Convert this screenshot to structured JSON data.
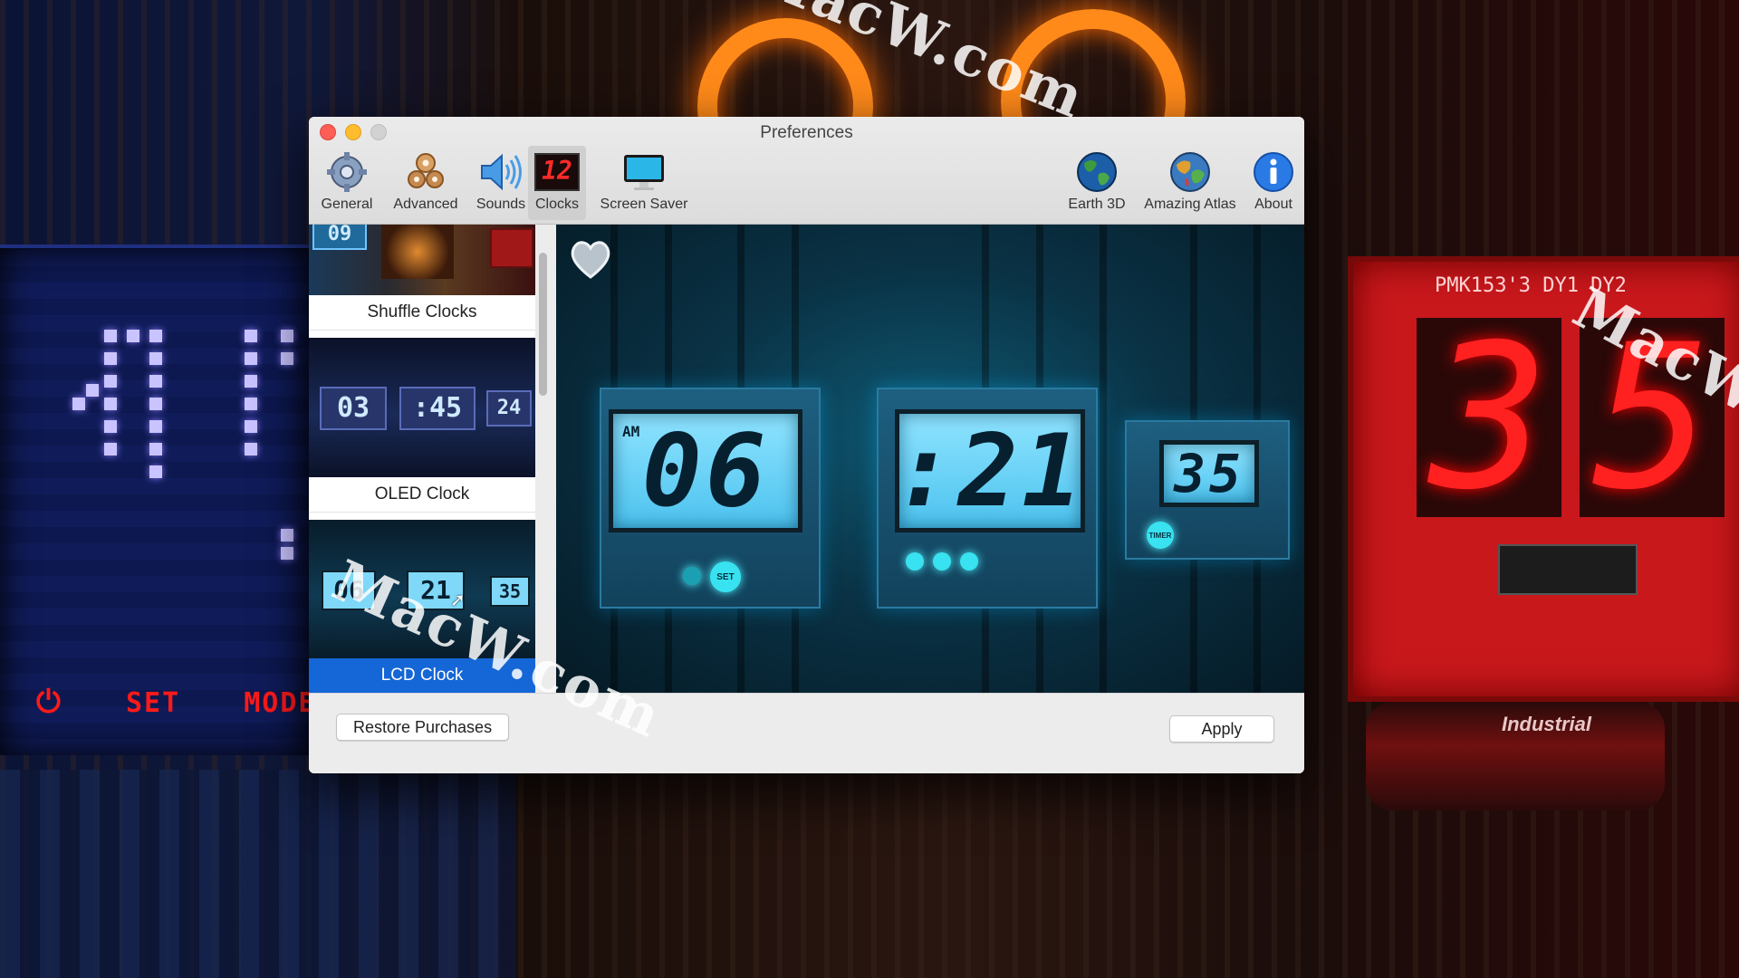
{
  "window": {
    "title": "Preferences"
  },
  "toolbar": {
    "items": [
      {
        "label": "General",
        "icon": "gear-icon"
      },
      {
        "label": "Advanced",
        "icon": "gears-icon"
      },
      {
        "label": "Sounds",
        "icon": "speaker-icon"
      },
      {
        "label": "Clocks",
        "icon": "clock-digit-icon"
      },
      {
        "label": "Screen Saver",
        "icon": "monitor-icon"
      },
      {
        "label": "Earth 3D",
        "icon": "earth-globe-icon"
      },
      {
        "label": "Amazing Atlas",
        "icon": "atlas-globe-icon"
      },
      {
        "label": "About",
        "icon": "info-icon"
      }
    ],
    "selected": "Clocks",
    "clocks_icon_text": "12"
  },
  "sidebar": {
    "items": [
      {
        "label": "Shuffle Clocks",
        "thumb_text": "09"
      },
      {
        "label": "OLED Clock",
        "thumb_digits": [
          "03",
          ":45",
          "24"
        ]
      },
      {
        "label": "LCD Clock",
        "thumb_digits": [
          "06",
          "21",
          "35"
        ]
      }
    ],
    "selected": "LCD Clock"
  },
  "preview": {
    "am_label": "AM",
    "hours": "06",
    "minutes": ":21",
    "seconds": "35",
    "set_label": "SET",
    "timer_label": "TIMER"
  },
  "buttons": {
    "restore": "Restore Purchases",
    "apply": "Apply"
  },
  "background": {
    "left_panel_labels": [
      "SET",
      "MODE"
    ],
    "red_board_label": "PMK153'3   DY1        DY2",
    "red_board_digits": [
      "3",
      "5"
    ],
    "battery_label": "Industrial"
  },
  "watermarks": [
    "MacW.com",
    "MacW.com",
    "MacW.com"
  ],
  "colors": {
    "selection": "#1566d6",
    "close": "#fd5f57",
    "minimize": "#febc2e",
    "lcd": "#4cc2ee"
  }
}
